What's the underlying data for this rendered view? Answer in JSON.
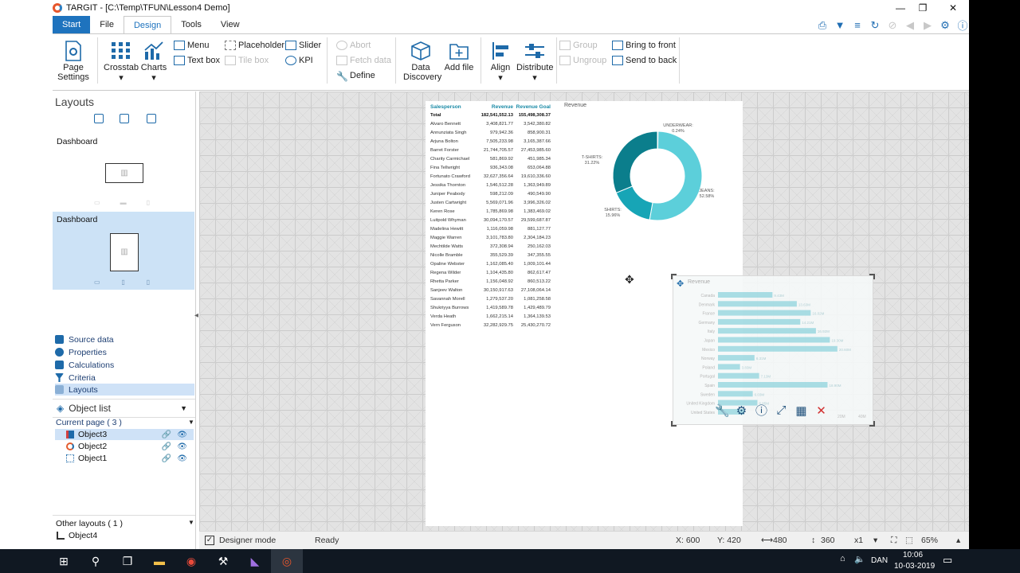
{
  "window": {
    "title": "TARGIT - [C:\\Temp\\TFUN\\Lesson4 Demo]"
  },
  "tabs": [
    "Start",
    "File",
    "Design",
    "Tools",
    "View"
  ],
  "ribbon": {
    "page_settings": "Page Settings",
    "crosstab": "Crosstab",
    "charts": "Charts",
    "menu": "Menu",
    "textbox": "Text box",
    "placeholder": "Placeholder",
    "tilebox": "Tile box",
    "slider": "Slider",
    "kpi": "KPI",
    "abort": "Abort",
    "fetch": "Fetch data",
    "define": "Define",
    "data_discovery": "Data Discovery",
    "add_file": "Add file",
    "align": "Align",
    "distribute": "Distribute",
    "group": "Group",
    "ungroup": "Ungroup",
    "bring_front": "Bring to front",
    "send_back": "Send to back"
  },
  "left": {
    "header": "Layouts",
    "dash1": "Dashboard",
    "dash2": "Dashboard",
    "nav": [
      "Source data",
      "Properties",
      "Calculations",
      "Criteria",
      "Layouts"
    ],
    "object_list": "Object list",
    "current_page": "Current page ( 3 )",
    "objects": [
      "Object3",
      "Object2",
      "Object1"
    ],
    "other_layouts": "Other layouts ( 1 )",
    "other_objects": [
      "Object4"
    ]
  },
  "table": {
    "headers": [
      "Salesperson",
      "Revenue",
      "Revenue Goal"
    ],
    "total": [
      "Total",
      "182,541,552.13",
      "155,498,308.37"
    ],
    "rows": [
      [
        "Alvaro Bennett",
        "3,408,821.77",
        "3,542,380.82"
      ],
      [
        "Annunziata Singh",
        "979,942.36",
        "858,900.31"
      ],
      [
        "Arjuna Bolton",
        "7,505,233.98",
        "3,165,387.66"
      ],
      [
        "Barret Forster",
        "21,744,705.57",
        "27,453,985.60"
      ],
      [
        "Charity Carmichael",
        "581,869.92",
        "451,985.34"
      ],
      [
        "Fina Tellwright",
        "936,343.08",
        "653,064.88"
      ],
      [
        "Fortunato Crawford",
        "32,627,356.64",
        "19,610,336.60"
      ],
      [
        "Jessika Thornton",
        "1,546,512.28",
        "1,363,949.89"
      ],
      [
        "Juniper Peabody",
        "598,212.09",
        "490,549.90"
      ],
      [
        "Justen Cartwright",
        "5,569,071.96",
        "3,996,326.02"
      ],
      [
        "Keren Rose",
        "1,785,869.98",
        "1,383,469.02"
      ],
      [
        "Luitpold Whyman",
        "30,094,170.57",
        "29,599,687.87"
      ],
      [
        "Madelina Hewitt",
        "1,116,059.98",
        "881,127.77"
      ],
      [
        "Maggie Warren",
        "3,101,783.80",
        "2,304,184.23"
      ],
      [
        "Mechtilde Watts",
        "372,308.94",
        "250,162.03"
      ],
      [
        "Nicolle Bramble",
        "355,529.39",
        "347,355.55"
      ],
      [
        "Opaline Webster",
        "1,162,085.40",
        "1,009,101.44"
      ],
      [
        "Regena Wilder",
        "1,104,435.80",
        "862,617.47"
      ],
      [
        "Rhetta Parker",
        "1,156,048.92",
        "860,513.22"
      ],
      [
        "Sanjeev Walton",
        "30,150,917.63",
        "27,108,064.14"
      ],
      [
        "Savannah Morell",
        "1,279,537.20",
        "1,081,258.58"
      ],
      [
        "Shukriyya Burrows",
        "1,419,589.78",
        "1,429,489.79"
      ],
      [
        "Verda Heath",
        "1,662,215.14",
        "1,364,139.53"
      ],
      [
        "Vern Ferguson",
        "32,282,929.75",
        "25,430,270.72"
      ]
    ]
  },
  "donut_label": "Revenue",
  "chart_data": [
    {
      "type": "pie",
      "title": "Revenue",
      "labels": [
        "UNDERWEAR",
        "JEANS",
        "SHIRTS",
        "T-SHIRTS"
      ],
      "values": [
        0.24,
        52.58,
        15.96,
        31.22
      ],
      "value_labels": [
        "0.24%",
        "52.58%",
        "15.96%",
        "31.22%"
      ],
      "colors": [
        "#2aa7b5",
        "#5ccfda",
        "#17a5b6",
        "#0b7e8c"
      ]
    },
    {
      "type": "bar",
      "title": "Revenue",
      "categories": [
        "Canada",
        "Denmark",
        "France",
        "Germany",
        "Italy",
        "Japan",
        "Mexico",
        "Norway",
        "Poland",
        "Portugal",
        "Spain",
        "Sweden",
        "United Kingdom",
        "United States"
      ],
      "values": [
        9.4,
        13.6,
        16.0,
        14.2,
        16.9,
        19.3,
        20.6,
        6.3,
        3.8,
        7.1,
        18.9,
        6.0,
        6.8,
        4.5
      ],
      "value_labels": [
        "9.43M",
        "13.63M",
        "16.02M",
        "14.21M",
        "16.92M",
        "19.30M",
        "20.60M",
        "6.31M",
        "3.83M",
        "7.13M",
        "18.90M",
        "6.03M",
        "6.85M",
        ""
      ],
      "xlabels": [
        "20M",
        "40M"
      ],
      "color": "#8fd3dc"
    }
  ],
  "status": {
    "designer_mode": "Designer mode",
    "ready": "Ready",
    "x": "X: 600",
    "y": "Y: 420",
    "w": "480",
    "h": "360",
    "mult": "x1",
    "zoom": "65%"
  },
  "taskbar": {
    "lang": "DAN",
    "time": "10:06",
    "date": "10-03-2019"
  }
}
